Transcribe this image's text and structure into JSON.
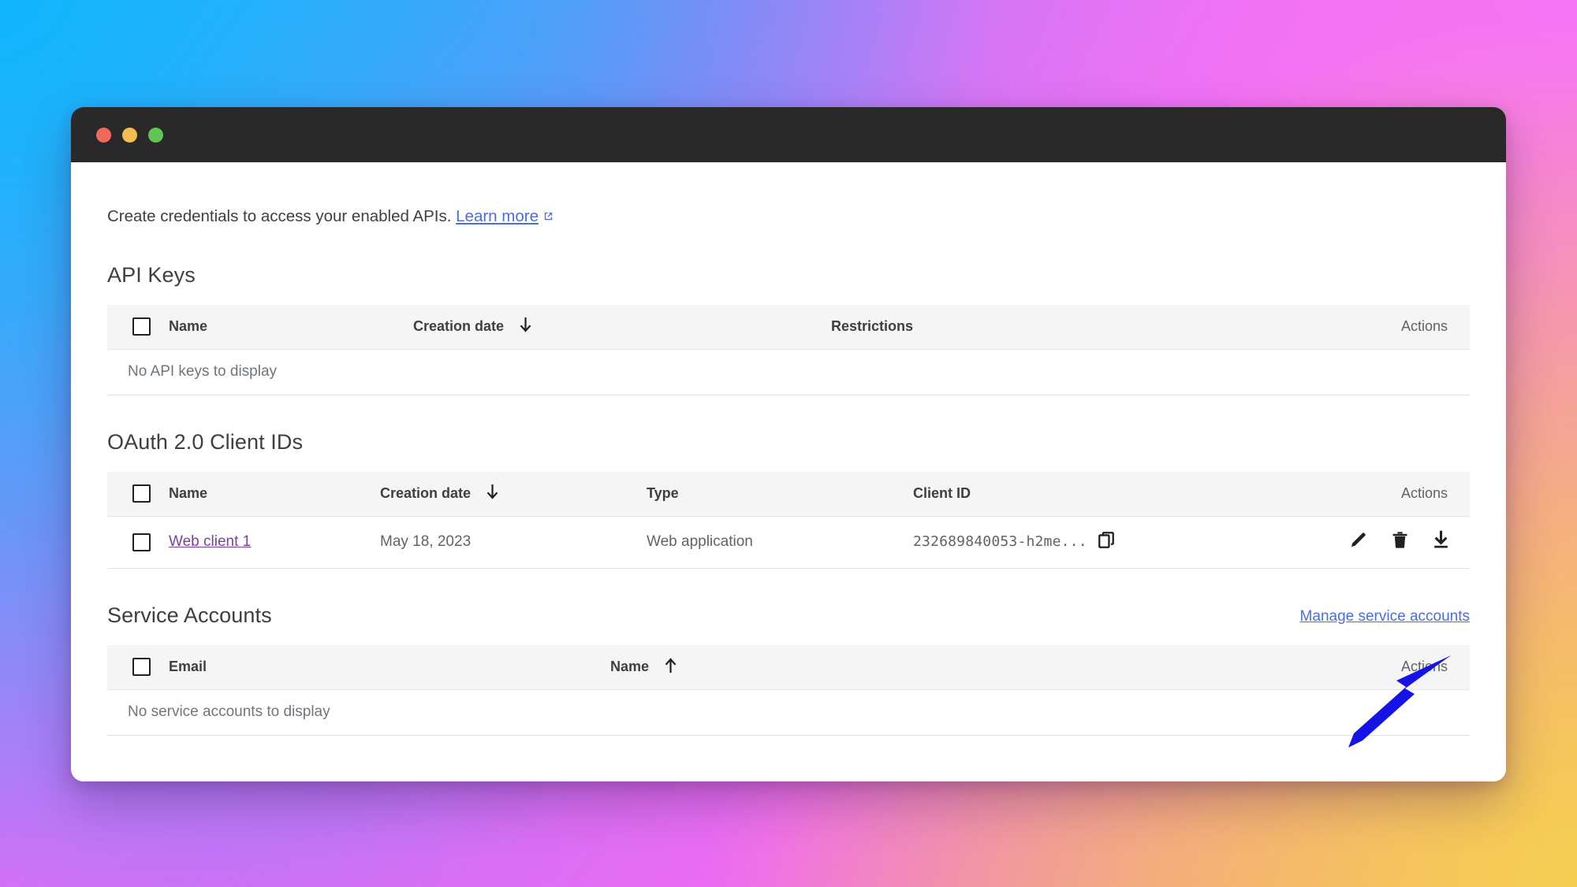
{
  "window": {
    "traffic_lights": [
      "close",
      "minimize",
      "maximize"
    ]
  },
  "intro": {
    "text": "Create credentials to access your enabled APIs.",
    "link_label": "Learn more",
    "link_icon": "external-link-icon"
  },
  "sections": {
    "api_keys": {
      "title": "API Keys",
      "columns": {
        "name": "Name",
        "creation_date": "Creation date",
        "restrictions": "Restrictions",
        "actions": "Actions"
      },
      "sort_indicator": "↓",
      "empty_message": "No API keys to display"
    },
    "oauth": {
      "title": "OAuth 2.0 Client IDs",
      "columns": {
        "name": "Name",
        "creation_date": "Creation date",
        "type": "Type",
        "client_id": "Client ID",
        "actions": "Actions"
      },
      "sort_indicator": "↓",
      "rows": [
        {
          "name": "Web client 1",
          "creation_date": "May 18, 2023",
          "type": "Web application",
          "client_id": "232689840053-h2me...",
          "actions": [
            "edit-icon",
            "delete-icon",
            "download-icon"
          ]
        }
      ]
    },
    "service_accounts": {
      "title": "Service Accounts",
      "manage_link": "Manage service accounts",
      "columns": {
        "email": "Email",
        "name": "Name",
        "actions": "Actions"
      },
      "sort_indicator": "↑",
      "empty_message": "No service accounts to display"
    }
  },
  "annotation": {
    "type": "arrow",
    "color": "#1414e6",
    "points_to": "download-icon"
  },
  "colors": {
    "link_blue": "#4a6ee0",
    "link_visited_purple": "#7b3fa0",
    "text_primary": "#3c4043",
    "text_secondary": "#5f6368",
    "table_header_bg": "#f5f5f5",
    "titlebar": "#292929",
    "annotation_arrow": "#1414e6"
  }
}
